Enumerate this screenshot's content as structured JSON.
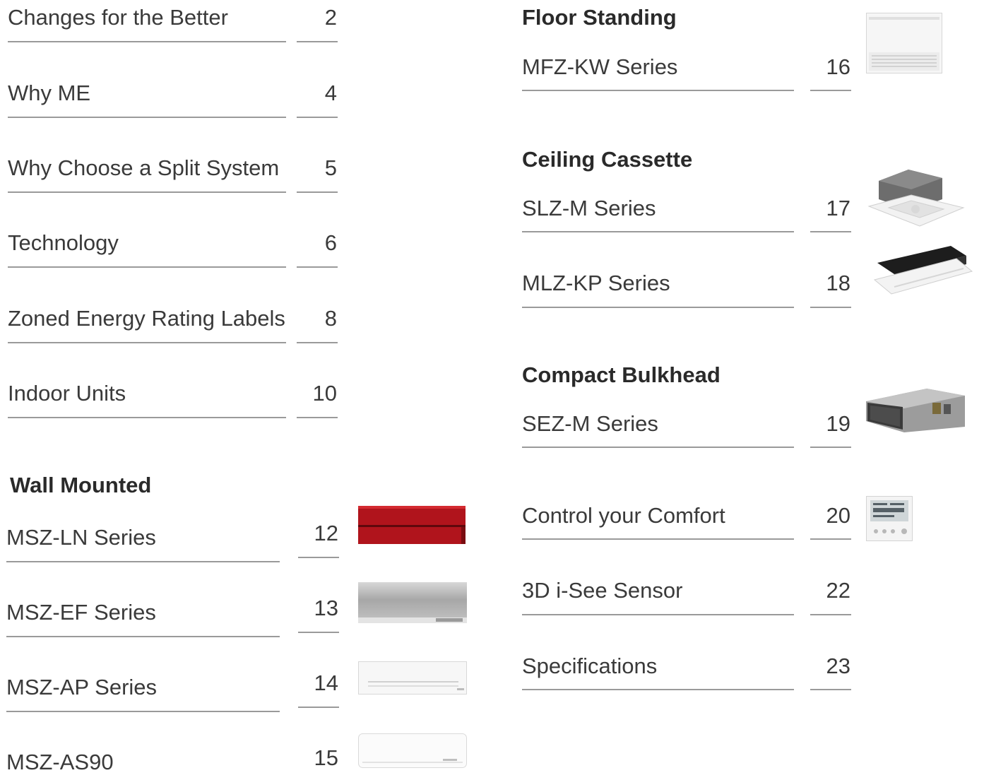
{
  "left_toc": [
    {
      "label": "Changes for the Better",
      "page": "2"
    },
    {
      "label": "Why ME",
      "page": "4"
    },
    {
      "label": "Why Choose a Split System",
      "page": "5"
    },
    {
      "label": "Technology",
      "page": "6"
    },
    {
      "label": "Zoned Energy Rating Labels",
      "page": "8"
    },
    {
      "label": "Indoor Units",
      "page": "10"
    }
  ],
  "wall_mounted": {
    "heading": "Wall Mounted",
    "items": [
      {
        "label": "MSZ-LN Series",
        "page": "12"
      },
      {
        "label": "MSZ-EF Series",
        "page": "13"
      },
      {
        "label": "MSZ-AP Series",
        "page": "14"
      },
      {
        "label": "MSZ-AS90",
        "page": "15"
      }
    ]
  },
  "floor_standing": {
    "heading": "Floor Standing",
    "items": [
      {
        "label": "MFZ-KW Series",
        "page": "16"
      }
    ]
  },
  "ceiling_cassette": {
    "heading": "Ceiling Cassette",
    "items": [
      {
        "label": "SLZ-M Series",
        "page": "17"
      },
      {
        "label": "MLZ-KP Series",
        "page": "18"
      }
    ]
  },
  "compact_bulkhead": {
    "heading": "Compact Bulkhead",
    "items": [
      {
        "label": "SEZ-M Series",
        "page": "19"
      }
    ]
  },
  "right_toc": [
    {
      "label": "Control your Comfort",
      "page": "20"
    },
    {
      "label": "3D i-See Sensor",
      "page": "22"
    },
    {
      "label": "Specifications",
      "page": "23"
    }
  ]
}
